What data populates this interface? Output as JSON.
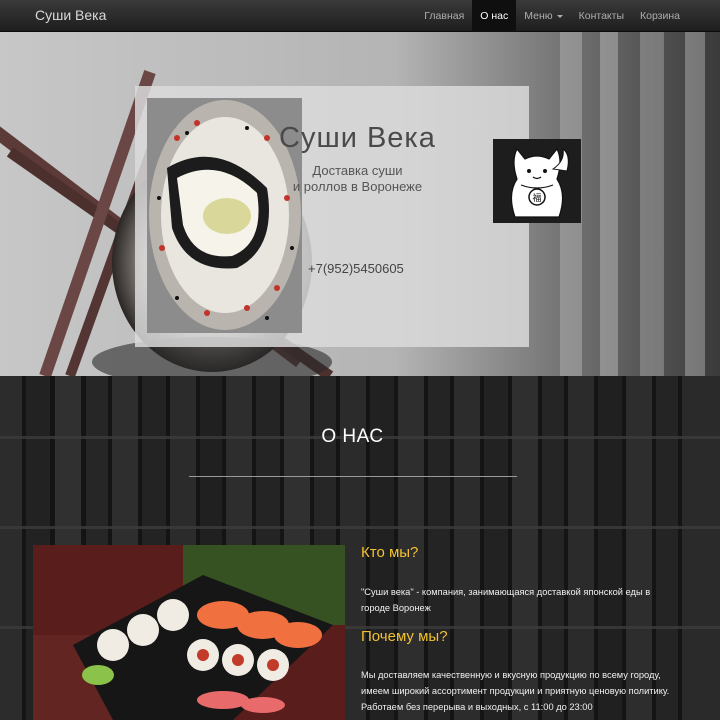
{
  "navbar": {
    "brand": "Суши Века",
    "items": [
      {
        "label": "Главная",
        "active": false
      },
      {
        "label": "О нас",
        "active": true
      },
      {
        "label": "Меню",
        "active": false,
        "dropdown": true
      },
      {
        "label": "Контакты",
        "active": false
      },
      {
        "label": "Корзина",
        "active": false
      }
    ]
  },
  "hero": {
    "title": "Суши Века",
    "subtitle_line1": "Доставка суши",
    "subtitle_line2": "и роллов в Воронеже",
    "phone": "+7(952)5450605",
    "logo_icon": "lucky-cat-icon"
  },
  "about": {
    "title": "О НАС",
    "who_title": "Кто мы?",
    "who_text": "\"Суши века\" - компания, занимающаяся доставкой японской еды в городе Воронеж",
    "why_title": "Почему мы?",
    "why_text": "Мы доставляем качественную и вкусную продукцию по всему городу, имеем широкий ассортимент продукции и приятную ценовую политику. Работаем без перерыва и выходных, с 11:00 до 23:00"
  },
  "colors": {
    "accent": "#f2c230",
    "navbar": "#222222",
    "active_nav": "#0f0f0f"
  }
}
